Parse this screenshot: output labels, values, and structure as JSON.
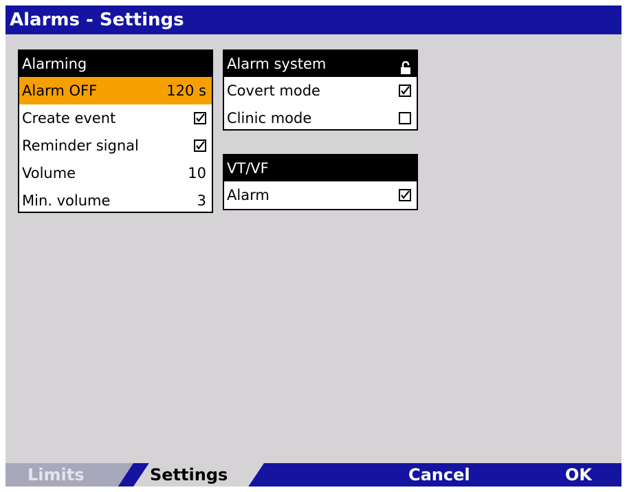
{
  "title": "Alarms - Settings",
  "alarming": {
    "header": "Alarming",
    "rows": [
      {
        "label": "Alarm OFF",
        "value": "120 s",
        "selected": true
      },
      {
        "label": "Create event",
        "checked": true
      },
      {
        "label": "Reminder signal",
        "checked": true
      },
      {
        "label": "Volume",
        "value": "10"
      },
      {
        "label": "Min. volume",
        "value": "3"
      }
    ]
  },
  "alarm_system": {
    "header": "Alarm system",
    "header_icon": "lock-icon",
    "rows": [
      {
        "label": "Covert mode",
        "checked": true
      },
      {
        "label": "Clinic mode",
        "checked": false
      }
    ]
  },
  "vtvf": {
    "header": "VT/VF",
    "rows": [
      {
        "label": "Alarm",
        "checked": true
      }
    ]
  },
  "tabs": [
    {
      "label": "Limits",
      "active": false
    },
    {
      "label": "Settings",
      "active": true
    }
  ],
  "actions": {
    "cancel": "Cancel",
    "ok": "OK"
  },
  "colors": {
    "title_bar": "#1414a0",
    "selection": "#f5a000",
    "background": "#d6d3d6"
  }
}
